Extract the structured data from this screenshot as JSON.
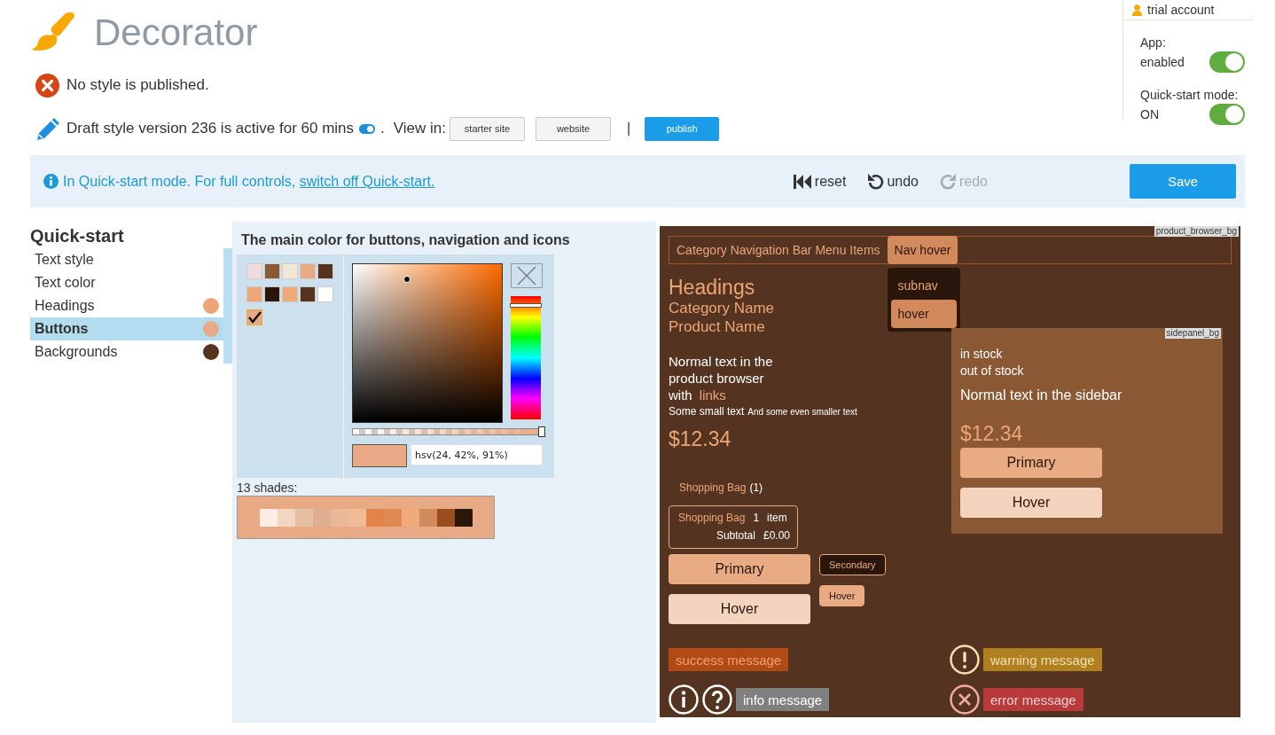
{
  "app": {
    "title": "Decorator"
  },
  "account": {
    "label": "trial account",
    "settings": [
      {
        "lines": [
          "App:",
          "enabled"
        ],
        "on": true
      },
      {
        "lines": [
          "Quick-start mode:",
          "ON"
        ],
        "on": true
      }
    ]
  },
  "publish_status": {
    "kind": "error",
    "text": "No style is published."
  },
  "draft": {
    "text": "Draft style version 236 is active for 60 mins",
    "timer_on": true,
    "suffix": ".",
    "view_label": "View in:",
    "view_buttons": [
      "starter site",
      "website"
    ],
    "separator": "|",
    "publish_button": "publish"
  },
  "notice": {
    "text": "In Quick-start mode. For full controls,",
    "link": "switch off Quick-start.",
    "actions": [
      {
        "kind": "reset",
        "label": "reset",
        "disabled": false
      },
      {
        "kind": "undo",
        "label": "undo",
        "disabled": false
      },
      {
        "kind": "redo",
        "label": "redo",
        "disabled": true
      }
    ],
    "save_button": "Save"
  },
  "sidebar": {
    "title": "Quick-start",
    "items": [
      {
        "label": "Text style",
        "selected": false
      },
      {
        "label": "Text color",
        "selected": false
      },
      {
        "label": "Headings",
        "selected": false,
        "color": "#eda577"
      },
      {
        "label": "Buttons",
        "selected": true,
        "color": "#e6aa84"
      },
      {
        "label": "Backgrounds",
        "selected": false,
        "color": "#55331f"
      }
    ]
  },
  "editor": {
    "title": "The main color for buttons, navigation and icons",
    "swatches": [
      {
        "color": "#f0dcdc",
        "selected": false
      },
      {
        "color": "#8b5a35",
        "selected": false
      },
      {
        "color": "#f3e8d8",
        "selected": false
      },
      {
        "color": "#e8aa84",
        "selected": false
      },
      {
        "color": "#55331f",
        "selected": false
      },
      {
        "color": "#eea878",
        "selected": false
      },
      {
        "color": "#2a160a",
        "selected": false
      },
      {
        "color": "#f0a878",
        "selected": false
      },
      {
        "color": "#55331f",
        "selected": false
      },
      {
        "color": "#ffffff",
        "selected": false
      },
      {
        "color": "#e8aa84",
        "selected": true
      }
    ],
    "brightness": {
      "level": 0.91
    },
    "hue": {
      "level": 0.93
    },
    "opacity": {
      "level": 1
    },
    "value": "hsv(24, 42%, 91%)",
    "shades_label": "13 shades:",
    "shades": [
      {
        "color": "#fbece6"
      },
      {
        "color": "#f3d6c2"
      },
      {
        "color": "#e6bfa3"
      },
      {
        "color": "#dfae91"
      },
      {
        "color": "#e8b898"
      },
      {
        "color": "#f0bc98"
      },
      {
        "color": "#e2844a"
      },
      {
        "color": "#de8a52"
      },
      {
        "color": "#f0aa7c"
      },
      {
        "color": "#cf8a5e"
      },
      {
        "color": "#9a4e20"
      },
      {
        "color": "#2a170a"
      }
    ]
  },
  "preview": {
    "label": "product_browser_bg",
    "nav_items": [
      {
        "label": "Category Navigation Bar Menu Items",
        "selected": false
      },
      {
        "label": "Nav hover",
        "selected": true
      }
    ],
    "submenu": [
      {
        "label": "subnav",
        "selected": false
      },
      {
        "label": "hover",
        "selected": true
      }
    ],
    "heading": "Headings",
    "category_name": "Category Name",
    "product_name": "Product Name",
    "body_text": "Normal text in the product browser with",
    "link": "links",
    "small_text": "Some small text",
    "smaller_text": "And some even smaller text",
    "price": "$12.34",
    "bag_link": "Shopping Bag",
    "bag_count": "(1)",
    "mini_bag": {
      "label": "Shopping Bag",
      "count": "1",
      "unit": "item",
      "subtotal_label": "Subtotal",
      "subtotal": "£0.00"
    },
    "buttons": [
      {
        "kind": "primary",
        "label": "Primary"
      },
      {
        "kind": "primary-hover",
        "label": "Hover"
      }
    ],
    "small_buttons": [
      {
        "kind": "secondary",
        "label": "Secondary"
      },
      {
        "kind": "secondary-hover",
        "label": "Hover"
      }
    ],
    "sidepanel": {
      "label": "sidepanel_bg",
      "stock": [
        "in stock",
        "out of stock"
      ],
      "text": "Normal text in the sidebar",
      "price": "$12.34",
      "buttons": [
        {
          "kind": "primary",
          "label": "Primary"
        },
        {
          "kind": "primary-hover",
          "label": "Hover"
        }
      ]
    },
    "messages": [
      {
        "kind": "success",
        "text": "success message"
      },
      {
        "kind": "warning",
        "text": "warning message"
      },
      {
        "kind": "info",
        "text": "info message"
      },
      {
        "kind": "error",
        "text": "error message"
      }
    ]
  }
}
